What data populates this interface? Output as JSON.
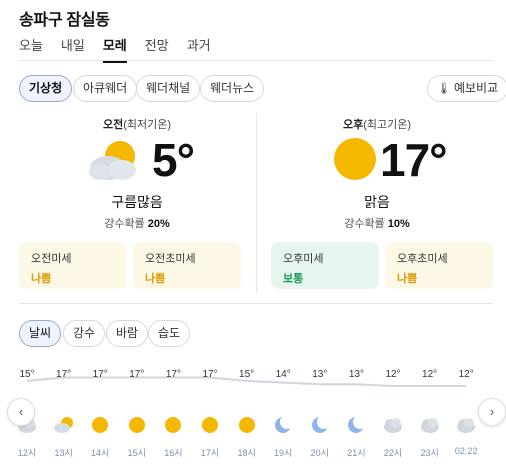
{
  "location": "송파구 잠실동",
  "day_tabs": [
    "오늘",
    "내일",
    "모레",
    "전망",
    "과거"
  ],
  "active_day": "모레",
  "sources": [
    "기상청",
    "아큐웨더",
    "웨더채널",
    "웨더뉴스"
  ],
  "active_source": "기상청",
  "compare_label": "예보비교",
  "am": {
    "label_main": "오전",
    "label_sub": "(최저기온)",
    "temp": "5°",
    "condition": "구름많음",
    "precip_label": "강수확률",
    "precip_value": "20%",
    "icon": "partly-cloudy-icon"
  },
  "pm": {
    "label_main": "오후",
    "label_sub": "(최고기온)",
    "temp": "17°",
    "condition": "맑음",
    "precip_label": "강수확률",
    "precip_value": "10%",
    "icon": "sun-icon"
  },
  "dust": [
    {
      "label": "오전미세",
      "value": "나쁨",
      "level": "bad"
    },
    {
      "label": "오전초미세",
      "value": "나쁨",
      "level": "bad"
    },
    {
      "label": "오후미세",
      "value": "보통",
      "level": "ok"
    },
    {
      "label": "오후초미세",
      "value": "나쁨",
      "level": "bad"
    }
  ],
  "detail_tabs": [
    "날씨",
    "강수",
    "바람",
    "습도"
  ],
  "active_detail_tab": "날씨",
  "hourly": [
    {
      "time": "12시",
      "temp": "15°",
      "icon": "cloud-icon"
    },
    {
      "time": "13시",
      "temp": "17°",
      "icon": "partly-cloudy-icon"
    },
    {
      "time": "14시",
      "temp": "17°",
      "icon": "sun-icon"
    },
    {
      "time": "15시",
      "temp": "17°",
      "icon": "sun-icon"
    },
    {
      "time": "16시",
      "temp": "17°",
      "icon": "sun-icon"
    },
    {
      "time": "17시",
      "temp": "17°",
      "icon": "sun-icon"
    },
    {
      "time": "18시",
      "temp": "15°",
      "icon": "sun-icon"
    },
    {
      "time": "19시",
      "temp": "14°",
      "icon": "moon-icon"
    },
    {
      "time": "20시",
      "temp": "13°",
      "icon": "moon-icon"
    },
    {
      "time": "21시",
      "temp": "13°",
      "icon": "moon-icon"
    },
    {
      "time": "22시",
      "temp": "12°",
      "icon": "cloud-icon"
    },
    {
      "time": "23시",
      "temp": "12°",
      "icon": "cloud-icon"
    },
    {
      "time": "02.22",
      "temp": "12°",
      "icon": "cloud-icon"
    }
  ],
  "colors": {
    "sun": "#f5b800",
    "moon": "#8fb4e8",
    "cloud": "#cfd6de",
    "bad": "#e09a00",
    "ok": "#179a57"
  }
}
